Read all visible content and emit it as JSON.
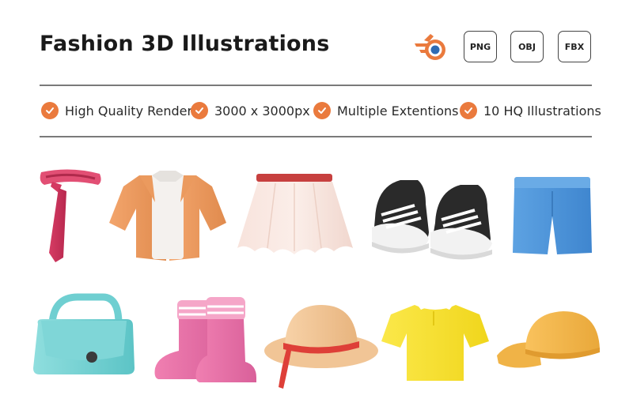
{
  "header": {
    "title": "Fashion 3D Illustrations",
    "software_icon": "blender-icon",
    "formats": [
      "PNG",
      "OBJ",
      "FBX"
    ]
  },
  "features": [
    {
      "icon": "check-circle-icon",
      "label": "High Quality Render"
    },
    {
      "icon": "check-circle-icon",
      "label": "3000 x 3000px"
    },
    {
      "icon": "check-circle-icon",
      "label": "Multiple Extentions"
    },
    {
      "icon": "check-circle-icon",
      "label": "10 HQ Illustrations"
    }
  ],
  "items": [
    {
      "icon": "necktie-icon"
    },
    {
      "icon": "shirt-icon"
    },
    {
      "icon": "skirt-icon"
    },
    {
      "icon": "sneakers-icon"
    },
    {
      "icon": "shorts-icon"
    },
    {
      "icon": "handbag-icon"
    },
    {
      "icon": "boots-icon"
    },
    {
      "icon": "sun-hat-icon"
    },
    {
      "icon": "polo-shirt-icon"
    },
    {
      "icon": "cap-icon"
    }
  ],
  "colors": {
    "accent": "#ea7a3d",
    "text": "#1a1a1a",
    "rule": "#7a7a7a"
  }
}
